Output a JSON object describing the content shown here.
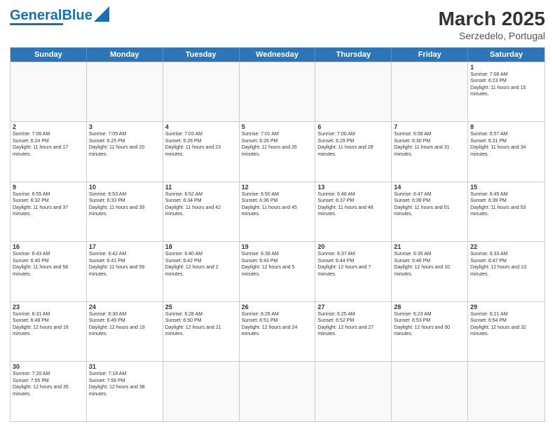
{
  "header": {
    "logo_general": "General",
    "logo_blue": "Blue",
    "month_year": "March 2025",
    "location": "Serzedelo, Portugal"
  },
  "weekdays": [
    "Sunday",
    "Monday",
    "Tuesday",
    "Wednesday",
    "Thursday",
    "Friday",
    "Saturday"
  ],
  "rows": [
    [
      {
        "day": "",
        "text": ""
      },
      {
        "day": "",
        "text": ""
      },
      {
        "day": "",
        "text": ""
      },
      {
        "day": "",
        "text": ""
      },
      {
        "day": "",
        "text": ""
      },
      {
        "day": "",
        "text": ""
      },
      {
        "day": "1",
        "text": "Sunrise: 7:08 AM\nSunset: 6:23 PM\nDaylight: 11 hours and 15 minutes."
      }
    ],
    [
      {
        "day": "2",
        "text": "Sunrise: 7:06 AM\nSunset: 6:24 PM\nDaylight: 11 hours and 17 minutes."
      },
      {
        "day": "3",
        "text": "Sunrise: 7:05 AM\nSunset: 6:25 PM\nDaylight: 11 hours and 20 minutes."
      },
      {
        "day": "4",
        "text": "Sunrise: 7:03 AM\nSunset: 6:26 PM\nDaylight: 11 hours and 23 minutes."
      },
      {
        "day": "5",
        "text": "Sunrise: 7:01 AM\nSunset: 6:28 PM\nDaylight: 11 hours and 26 minutes."
      },
      {
        "day": "6",
        "text": "Sunrise: 7:00 AM\nSunset: 6:29 PM\nDaylight: 11 hours and 28 minutes."
      },
      {
        "day": "7",
        "text": "Sunrise: 6:58 AM\nSunset: 6:30 PM\nDaylight: 11 hours and 31 minutes."
      },
      {
        "day": "8",
        "text": "Sunrise: 6:57 AM\nSunset: 6:31 PM\nDaylight: 11 hours and 34 minutes."
      }
    ],
    [
      {
        "day": "9",
        "text": "Sunrise: 6:55 AM\nSunset: 6:32 PM\nDaylight: 11 hours and 37 minutes."
      },
      {
        "day": "10",
        "text": "Sunrise: 6:53 AM\nSunset: 6:33 PM\nDaylight: 11 hours and 39 minutes."
      },
      {
        "day": "11",
        "text": "Sunrise: 6:52 AM\nSunset: 6:34 PM\nDaylight: 11 hours and 42 minutes."
      },
      {
        "day": "12",
        "text": "Sunrise: 6:50 AM\nSunset: 6:36 PM\nDaylight: 11 hours and 45 minutes."
      },
      {
        "day": "13",
        "text": "Sunrise: 6:48 AM\nSunset: 6:37 PM\nDaylight: 11 hours and 48 minutes."
      },
      {
        "day": "14",
        "text": "Sunrise: 6:47 AM\nSunset: 6:38 PM\nDaylight: 11 hours and 51 minutes."
      },
      {
        "day": "15",
        "text": "Sunrise: 6:45 AM\nSunset: 6:39 PM\nDaylight: 11 hours and 53 minutes."
      }
    ],
    [
      {
        "day": "16",
        "text": "Sunrise: 6:43 AM\nSunset: 6:40 PM\nDaylight: 11 hours and 56 minutes."
      },
      {
        "day": "17",
        "text": "Sunrise: 6:42 AM\nSunset: 6:41 PM\nDaylight: 11 hours and 59 minutes."
      },
      {
        "day": "18",
        "text": "Sunrise: 6:40 AM\nSunset: 6:42 PM\nDaylight: 12 hours and 2 minutes."
      },
      {
        "day": "19",
        "text": "Sunrise: 6:38 AM\nSunset: 6:43 PM\nDaylight: 12 hours and 5 minutes."
      },
      {
        "day": "20",
        "text": "Sunrise: 6:37 AM\nSunset: 6:44 PM\nDaylight: 12 hours and 7 minutes."
      },
      {
        "day": "21",
        "text": "Sunrise: 6:35 AM\nSunset: 6:46 PM\nDaylight: 12 hours and 10 minutes."
      },
      {
        "day": "22",
        "text": "Sunrise: 6:33 AM\nSunset: 6:47 PM\nDaylight: 12 hours and 13 minutes."
      }
    ],
    [
      {
        "day": "23",
        "text": "Sunrise: 6:31 AM\nSunset: 6:48 PM\nDaylight: 12 hours and 16 minutes."
      },
      {
        "day": "24",
        "text": "Sunrise: 6:30 AM\nSunset: 6:49 PM\nDaylight: 12 hours and 19 minutes."
      },
      {
        "day": "25",
        "text": "Sunrise: 6:28 AM\nSunset: 6:50 PM\nDaylight: 12 hours and 21 minutes."
      },
      {
        "day": "26",
        "text": "Sunrise: 6:26 AM\nSunset: 6:51 PM\nDaylight: 12 hours and 24 minutes."
      },
      {
        "day": "27",
        "text": "Sunrise: 6:25 AM\nSunset: 6:52 PM\nDaylight: 12 hours and 27 minutes."
      },
      {
        "day": "28",
        "text": "Sunrise: 6:23 AM\nSunset: 6:53 PM\nDaylight: 12 hours and 30 minutes."
      },
      {
        "day": "29",
        "text": "Sunrise: 6:21 AM\nSunset: 6:54 PM\nDaylight: 12 hours and 32 minutes."
      }
    ],
    [
      {
        "day": "30",
        "text": "Sunrise: 7:20 AM\nSunset: 7:55 PM\nDaylight: 12 hours and 35 minutes."
      },
      {
        "day": "31",
        "text": "Sunrise: 7:18 AM\nSunset: 7:56 PM\nDaylight: 12 hours and 38 minutes."
      },
      {
        "day": "",
        "text": ""
      },
      {
        "day": "",
        "text": ""
      },
      {
        "day": "",
        "text": ""
      },
      {
        "day": "",
        "text": ""
      },
      {
        "day": "",
        "text": ""
      }
    ]
  ]
}
